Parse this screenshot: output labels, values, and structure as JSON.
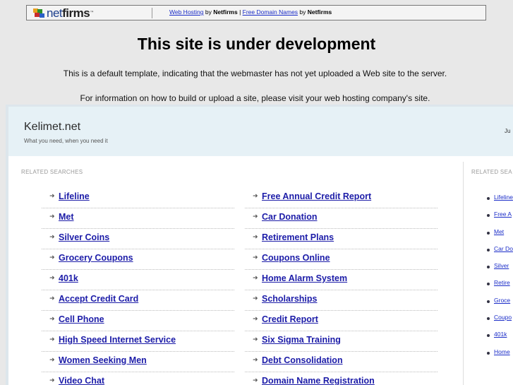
{
  "topbar": {
    "logo_text_bold": "net",
    "logo_text_rest": "firms",
    "link1": "Web Hosting",
    "by1": " by ",
    "brand1": "Netfirms",
    "divider": " | ",
    "link2": "Free Domain Names",
    "by2": " by ",
    "brand2": "Netfirms"
  },
  "main": {
    "heading": "This site is under development",
    "para1": "This is a default template, indicating that the webmaster has not yet uploaded a Web site to the server.",
    "para2": "For information on how to build or upload a site, please visit your web hosting company's site."
  },
  "parked": {
    "site_title": "Kelimet.net",
    "tagline": "What you need, when you need it",
    "date_fragment": "Ju",
    "related_label": "RELATED SEARCHES",
    "related_label_right": "RELATED SEA",
    "left_links": [
      "Lifeline",
      "Met",
      "Silver Coins",
      "Grocery Coupons",
      "401k",
      "Accept Credit Card",
      "Cell Phone",
      "High Speed Internet Service",
      "Women Seeking Men",
      "Video Chat"
    ],
    "right_links": [
      "Free Annual Credit Report",
      "Car Donation",
      "Retirement Plans",
      "Coupons Online",
      "Home Alarm System",
      "Scholarships",
      "Credit Report",
      "Six Sigma Training",
      "Debt Consolidation",
      "Domain Name Registration"
    ],
    "side_links": [
      "Lifeline",
      "Free A",
      "Met",
      "Car Do",
      "Silver",
      "Retire",
      "Groce",
      "Coupo",
      "401k",
      "Home"
    ]
  },
  "colors": {
    "link": "#1c1ca8",
    "header_bg": "#e6f1f6",
    "page_bg": "#e8e8e8"
  }
}
